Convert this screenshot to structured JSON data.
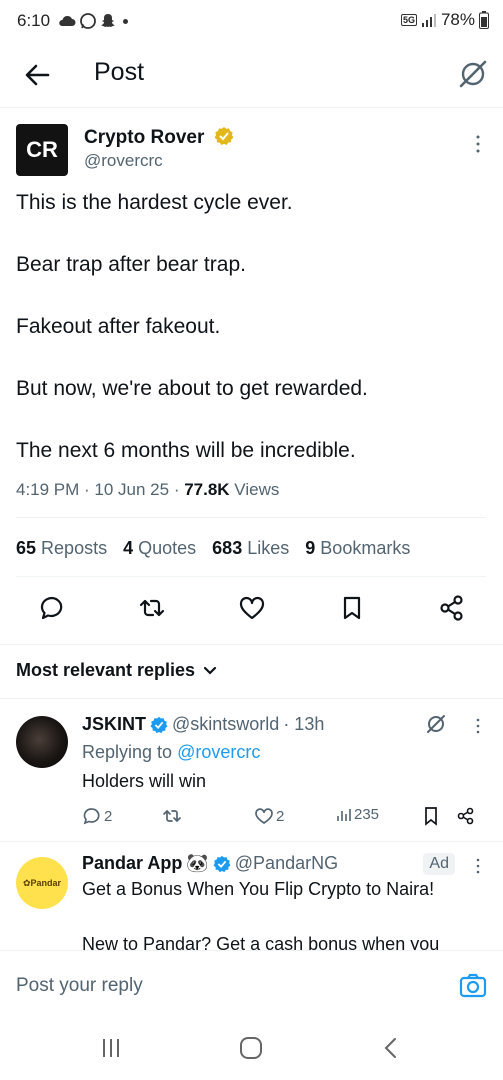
{
  "status_bar": {
    "time": "6:10",
    "battery": "78%",
    "network": "5G"
  },
  "header": {
    "title": "Post"
  },
  "tweet": {
    "author_name": "Crypto Rover",
    "author_handle": "@rovercrc",
    "avatar_text": "CR",
    "lines": [
      "This is the hardest cycle ever.",
      "Bear trap after bear trap.",
      "Fakeout after fakeout.",
      "But now, we're about to get rewarded.",
      "The next 6 months will be incredible."
    ],
    "time": "4:19 PM · 10 Jun 25 · ",
    "views_count": "77.8K",
    "views_label": " Views",
    "stats": {
      "reposts_count": "65",
      "reposts_label": "Reposts",
      "quotes_count": "4",
      "quotes_label": "Quotes",
      "likes_count": "683",
      "likes_label": "Likes",
      "bookmarks_count": "9",
      "bookmarks_label": "Bookmarks"
    }
  },
  "replies_sort": {
    "label": "Most relevant replies"
  },
  "reply": {
    "author_name": "JSKINT",
    "author_handle": "@skintsworld",
    "time": "· 13h",
    "replying_prefix": "Replying to ",
    "replying_to": "@rovercrc",
    "text": "Holders will win",
    "reply_count": "2",
    "like_count": "2",
    "view_count": "235"
  },
  "ad": {
    "author_name": "Pandar App",
    "emoji": "🐼",
    "author_handle": "@PandarNG",
    "badge": "Ad",
    "avatar_text": "✿Pandar",
    "text": "Get a Bonus When You Flip Crypto to Naira!",
    "text2": "New to Pandar? Get a cash bonus when you"
  },
  "reply_bar": {
    "placeholder": "Post your reply"
  },
  "colors": {
    "accent": "#1d9bf0",
    "verified": "#e2b719",
    "text": "#0f1419",
    "muted": "#536471"
  }
}
